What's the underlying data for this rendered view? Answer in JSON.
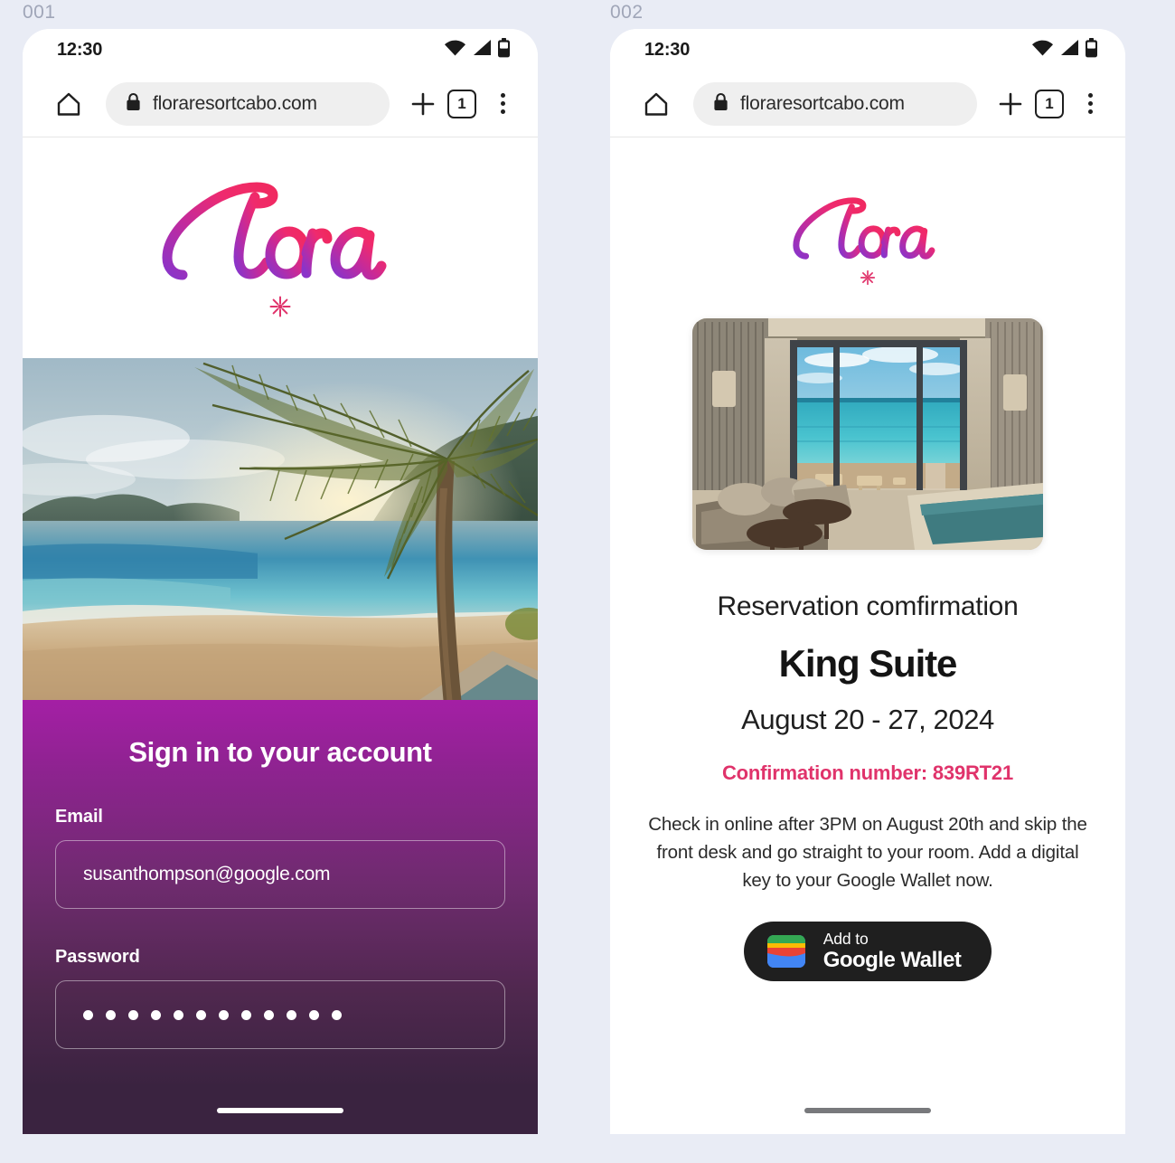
{
  "page": {
    "background_color": "#e9ecf5"
  },
  "screens": [
    {
      "label": "001",
      "status_bar": {
        "time": "12:30",
        "wifi_icon": "wifi-icon",
        "signal_icon": "cell-signal-icon",
        "battery_icon": "battery-icon"
      },
      "browser": {
        "home_icon": "home-icon",
        "lock_icon": "lock-icon",
        "url": "floraresortcabo.com",
        "new_tab_icon": "plus-icon",
        "tab_count": "1",
        "menu_icon": "overflow-menu-icon"
      },
      "brand": {
        "wordmark": "Flora",
        "burst_icon": "asterisk-burst-icon",
        "gradient_from": "#ef2a6e",
        "gradient_to": "#9b30c9"
      },
      "hero_image": {
        "alt": "tropical-beach-palm-sunset"
      },
      "signin": {
        "title": "Sign in to your account",
        "email_label": "Email",
        "email_value": "susanthompson@google.com",
        "email_placeholder": "Email",
        "password_label": "Password",
        "password_masked_length": 12,
        "password_placeholder": "Password",
        "panel_gradient_from": "#a41fa5",
        "panel_gradient_to": "#3a2340"
      },
      "nav_bar": {
        "pill_color": "#ffffff"
      }
    },
    {
      "label": "002",
      "status_bar": {
        "time": "12:30",
        "wifi_icon": "wifi-icon",
        "signal_icon": "cell-signal-icon",
        "battery_icon": "battery-icon"
      },
      "browser": {
        "home_icon": "home-icon",
        "lock_icon": "lock-icon",
        "url": "floraresortcabo.com",
        "new_tab_icon": "plus-icon",
        "tab_count": "1",
        "menu_icon": "overflow-menu-icon"
      },
      "brand": {
        "wordmark": "Flora",
        "burst_icon": "asterisk-burst-icon",
        "gradient_from": "#ef2a6e",
        "gradient_to": "#9b30c9"
      },
      "room_image": {
        "alt": "hotel-suite-ocean-view"
      },
      "confirmation": {
        "subtitle": "Reservation comfirmation",
        "room_type": "King Suite",
        "dates": "August 20 - 27, 2024",
        "confirmation_number": "Confirmation number: 839RT21",
        "confirmation_color": "#e0336b",
        "body": "Check in online after 3PM on August 20th and skip the front desk and go straight to your room. Add a digital key to your Google Wallet now.",
        "wallet_button": {
          "small_label": "Add to",
          "big_label": "Google Wallet",
          "icon": "google-wallet-icon",
          "background_color": "#1f1f1f"
        }
      },
      "nav_bar": {
        "pill_color": "#78797c"
      }
    }
  ]
}
